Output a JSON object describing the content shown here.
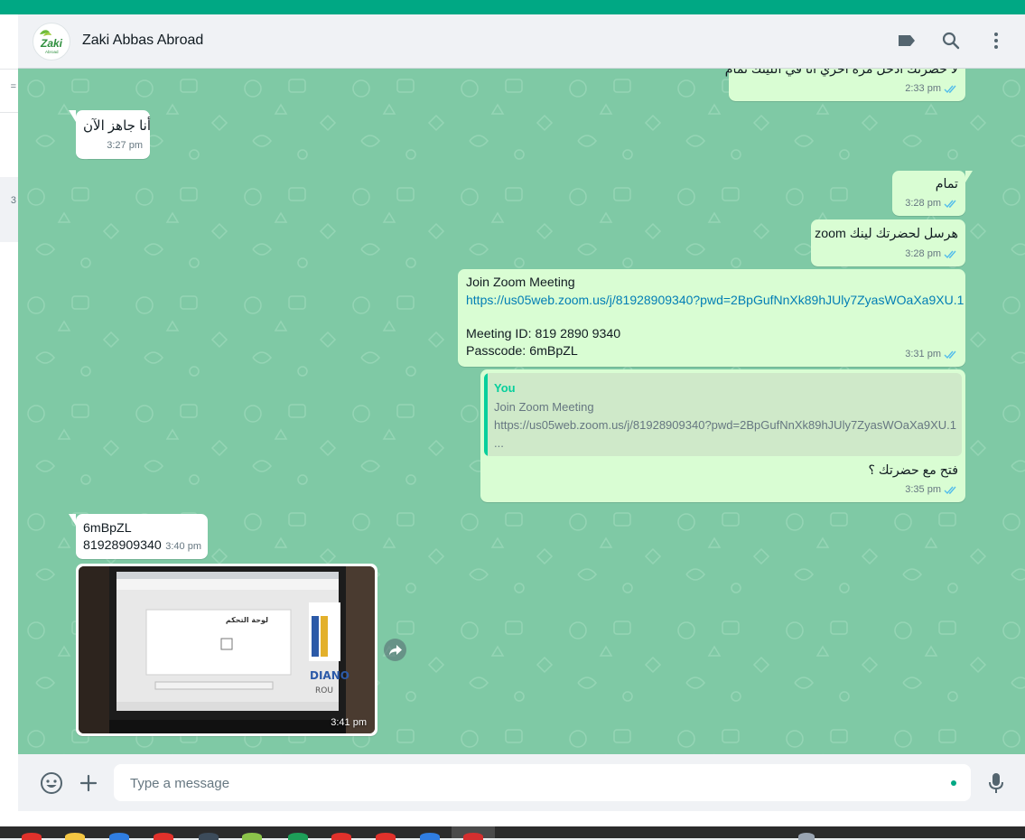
{
  "colors": {
    "accent": "#00a884",
    "chat_bg": "#7fc9a5",
    "incoming_bubble": "#ffffff",
    "outgoing_bubble": "#d9fdd3",
    "link": "#027eb5",
    "read_ticks": "#53bdeb"
  },
  "header": {
    "contact_name": "Zaki Abbas Abroad",
    "avatar_text": "Zaki",
    "avatar_subtext": "Abroad",
    "icons": [
      "label-icon",
      "search-icon",
      "menu-icon"
    ]
  },
  "left_pane": {
    "glyphs": [
      "=",
      "3"
    ]
  },
  "messages": [
    {
      "id": "m1",
      "direction": "out",
      "text": "لا حضرتك ادخل مرة اخري انا في اللينك تمام",
      "time": "2:33 pm",
      "status": "read"
    },
    {
      "id": "m2",
      "direction": "in",
      "text": "أنا جاهز الآن",
      "time": "3:27 pm"
    },
    {
      "id": "m3",
      "direction": "out",
      "text": "تمام",
      "time": "3:28 pm",
      "status": "read"
    },
    {
      "id": "m4",
      "direction": "out",
      "text": "هرسل لحضرتك لينك zoom",
      "time": "3:28 pm",
      "status": "read"
    },
    {
      "id": "m5",
      "direction": "out",
      "lines": [
        "Join Zoom Meeting",
        "https://us05web.zoom.us/j/81928909340?pwd=2BpGufNnXk89hJUly7ZyasWOaXa9XU.1",
        "",
        "Meeting ID: 819 2890 9340",
        "Passcode: 6mBpZL"
      ],
      "time": "3:31 pm",
      "status": "read"
    },
    {
      "id": "m6",
      "direction": "out",
      "quote": {
        "author": "You",
        "lines": [
          "Join Zoom Meeting",
          "https://us05web.zoom.us/j/81928909340?pwd=2BpGufNnXk89hJUly7ZyasWOaXa9XU.1",
          "..."
        ]
      },
      "text": "فتح مع حضرتك ؟",
      "time": "3:35 pm",
      "status": "read"
    },
    {
      "id": "m7",
      "direction": "in",
      "lines": [
        "6mBpZL",
        "81928909340"
      ],
      "time": "3:40 pm"
    },
    {
      "id": "m8",
      "direction": "in",
      "type": "image",
      "image_desc": "photo of a laptop screen",
      "screen_texts": [
        "لوحة التحكم",
        "DIANO",
        "ROU"
      ],
      "time": "3:41 pm"
    }
  ],
  "composer": {
    "placeholder": "Type a message",
    "icons": [
      "emoji-icon",
      "attach-plus-icon",
      "microphone-icon"
    ]
  }
}
